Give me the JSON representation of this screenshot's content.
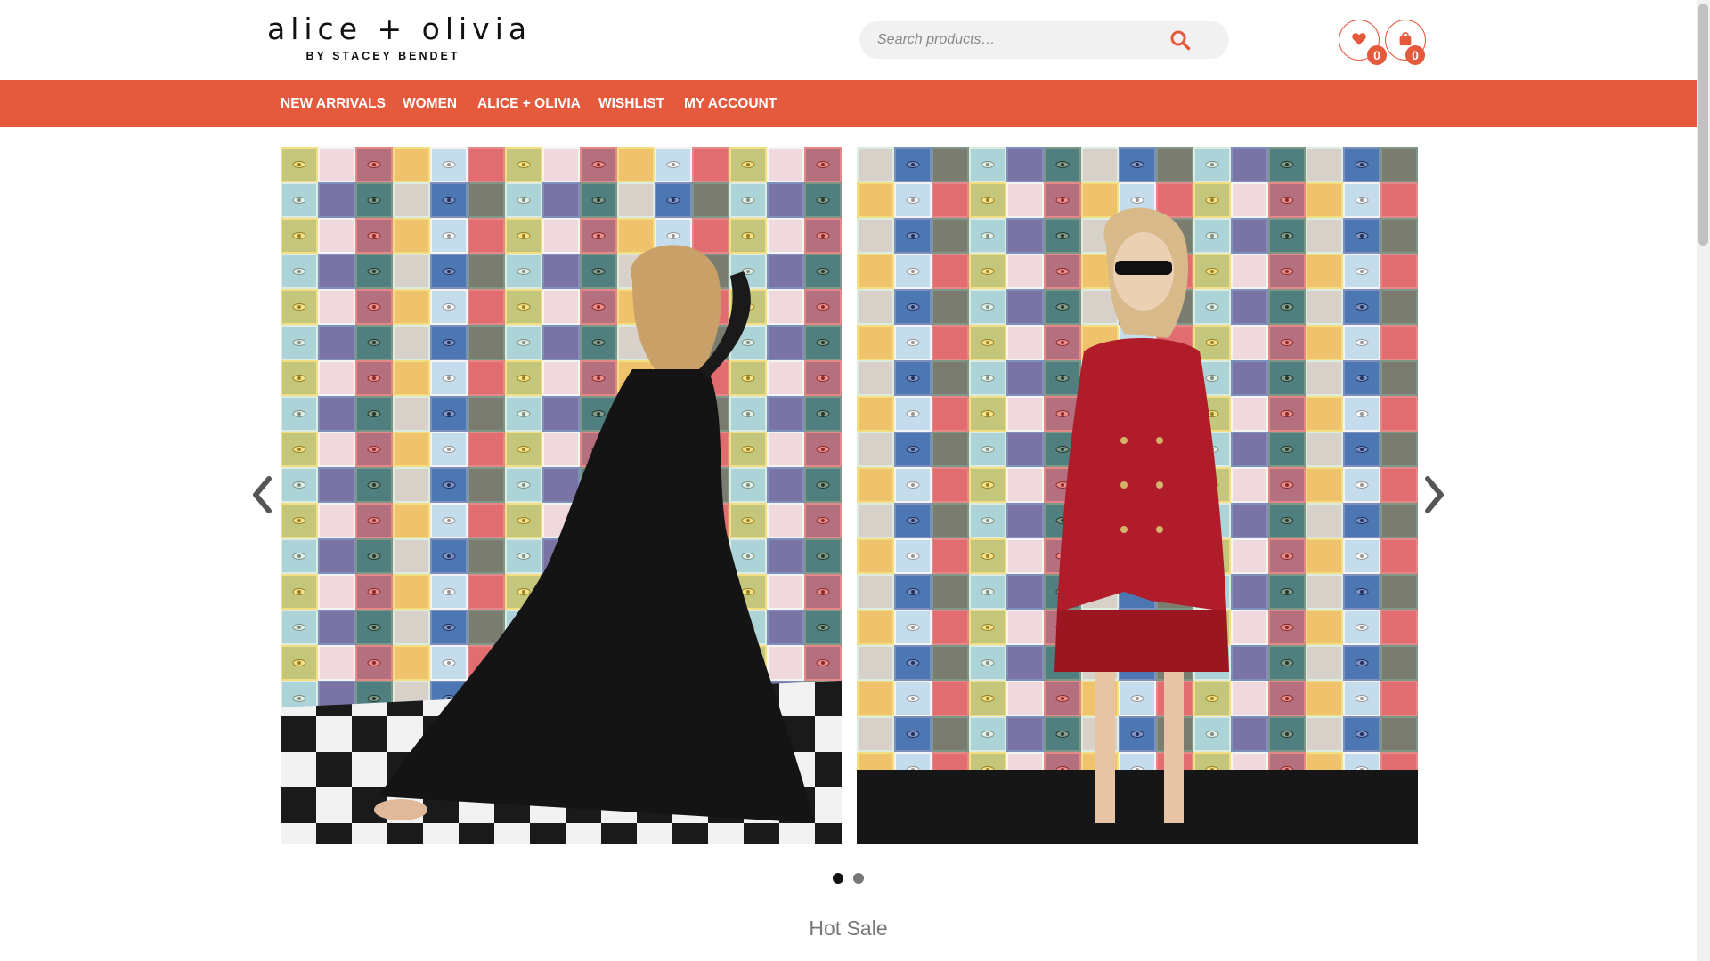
{
  "brand": {
    "logo_main": "alice + olivia",
    "logo_sub": "BY STACEY BENDET"
  },
  "search": {
    "placeholder": "Search products…",
    "icon": "search-icon"
  },
  "header_icons": {
    "wishlist_icon": "heart-icon",
    "wishlist_count": "0",
    "cart_icon": "bag-icon",
    "cart_count": "0"
  },
  "nav": {
    "items": [
      "NEW ARRIVALS",
      "WOMEN",
      "ALICE + OLIVIA",
      "WISHLIST",
      "MY ACCOUNT"
    ]
  },
  "slider": {
    "prev_icon": "chevron-left-icon",
    "next_icon": "chevron-right-icon",
    "slides": [
      {
        "image": "woman-black-lace-gown-tiled-wall"
      },
      {
        "image": "woman-red-blazer-dress-tiled-wall"
      }
    ],
    "active_dot": 1,
    "dot_count": 2
  },
  "section": {
    "title": "Hot Sale"
  },
  "colors": {
    "accent": "#e5593c",
    "nav_text": "#ffffff",
    "search_bg": "#f1f1f1"
  }
}
